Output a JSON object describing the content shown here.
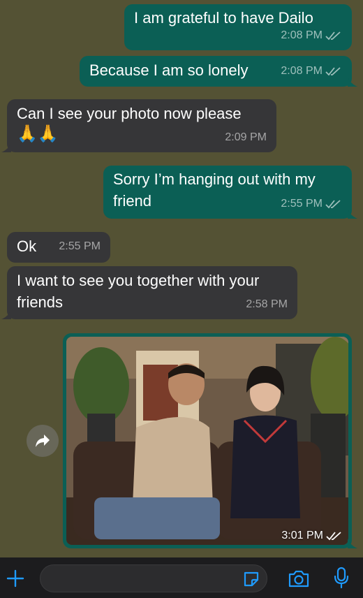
{
  "colors": {
    "background": "#545234",
    "outgoing_bubble": "#0b5f55",
    "incoming_bubble": "#363638",
    "accent_blue": "#1f9bff"
  },
  "messages": [
    {
      "direction": "out",
      "text": "I am grateful to have Dailo",
      "time": "2:08 PM",
      "status": "read"
    },
    {
      "direction": "out",
      "text": "Because I am so lonely",
      "time": "2:08 PM",
      "status": "read"
    },
    {
      "direction": "in",
      "text": "Can I see your photo now please",
      "emoji": "🙏🙏",
      "time": "2:09 PM"
    },
    {
      "direction": "out",
      "text": "Sorry I’m hanging out with my friend",
      "time": "2:55 PM",
      "status": "read"
    },
    {
      "direction": "in",
      "text": "Ok",
      "time": "2:55 PM"
    },
    {
      "direction": "in",
      "text": "I want to see you together with your friends",
      "time": "2:58 PM"
    },
    {
      "direction": "out",
      "type": "photo",
      "time": "3:01 PM",
      "status": "read"
    }
  ],
  "composer": {
    "add_icon": "plus-icon",
    "sticker_icon": "sticker-icon",
    "camera_icon": "camera-icon",
    "mic_icon": "microphone-icon"
  },
  "forward_icon": "forward-arrow-icon"
}
